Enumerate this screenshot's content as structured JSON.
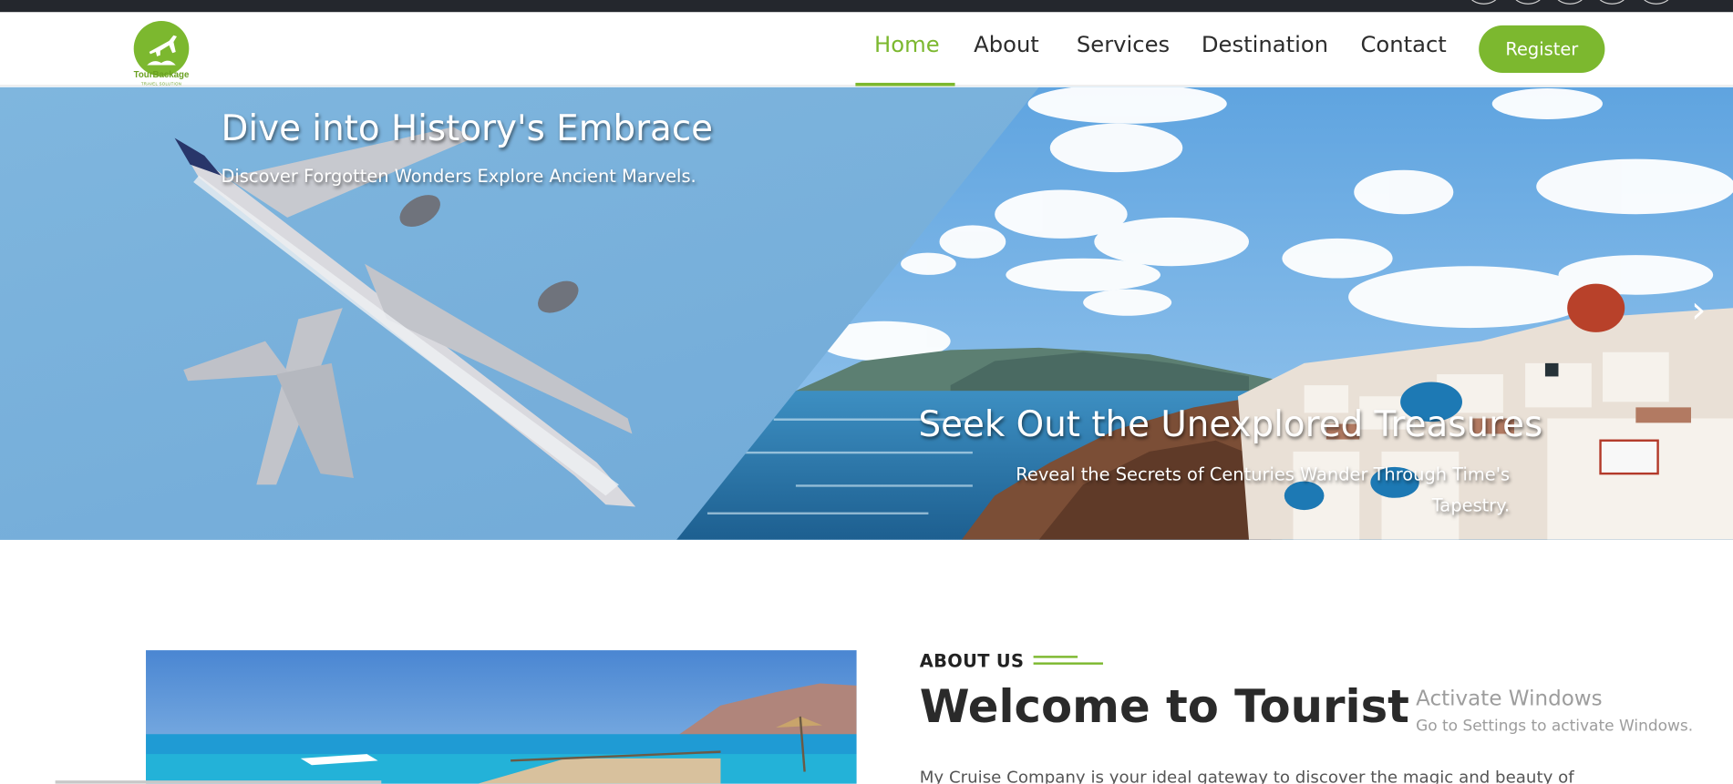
{
  "nav": {
    "logo_text": "TourBackage",
    "logo_sub": "TRAVEL SOLUTION",
    "items": [
      {
        "label": "Home",
        "active": true
      },
      {
        "label": "About",
        "active": false
      },
      {
        "label": "Services",
        "active": false
      },
      {
        "label": "Destination",
        "active": false
      },
      {
        "label": "Contact",
        "active": false
      }
    ],
    "register_label": "Register",
    "accent_color": "#7cb82f"
  },
  "hero": {
    "slide_left_title": "Dive into History's Embrace",
    "slide_left_subtitle": "Discover Forgotten Wonders Explore Ancient Marvels.",
    "slide_right_title": "Seek Out the Unexplored Treasures",
    "slide_right_subtitle": "Reveal the Secrets of Centuries Wander Through Time's Tapestry.",
    "next_icon": "chevron-right-icon"
  },
  "about": {
    "label": "ABOUT US",
    "heading": "Welcome to Tourist",
    "paragraph": "My Cruise Company is your ideal gateway to discover the magic and beauty of"
  },
  "watermark": {
    "line1": "Activate Windows",
    "line2": "Go to Settings to activate Windows."
  }
}
